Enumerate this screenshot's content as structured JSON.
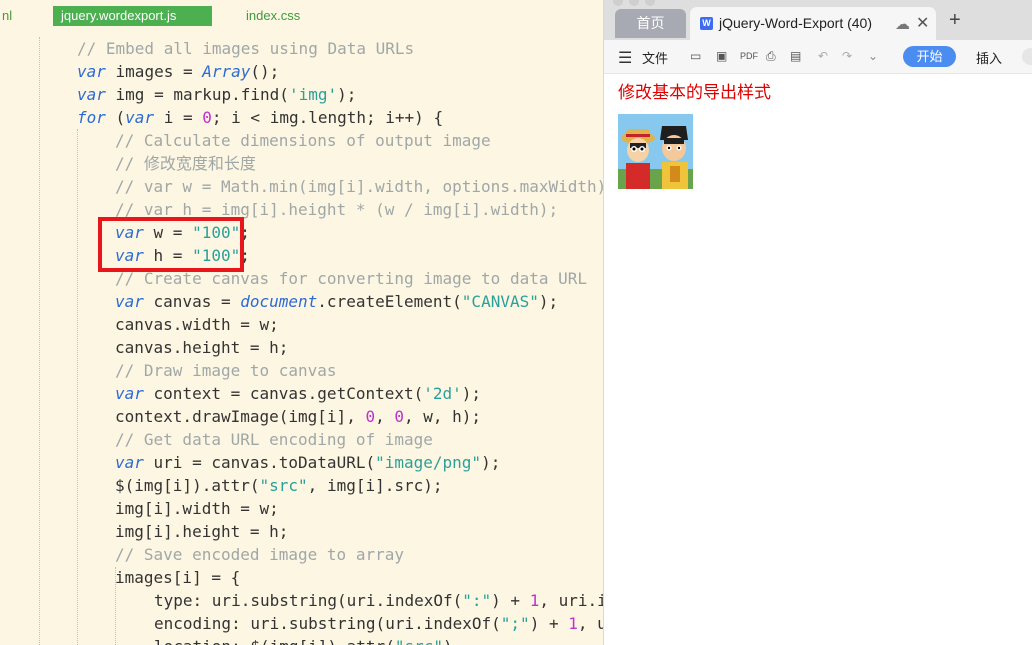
{
  "editor": {
    "tabs": [
      {
        "label": "nl"
      },
      {
        "label": "jquery.wordexport.js",
        "active": true
      },
      {
        "label": "index.css"
      }
    ],
    "lines": [
      [
        {
          "t": "// Embed all images using Data URLs",
          "c": "cm"
        }
      ],
      [
        {
          "t": "var",
          "c": "kw"
        },
        {
          "t": " images = "
        },
        {
          "t": "Array",
          "c": "ty"
        },
        {
          "t": "();"
        }
      ],
      [
        {
          "t": "var",
          "c": "kw"
        },
        {
          "t": " img = markup.find("
        },
        {
          "t": "'img'",
          "c": "st"
        },
        {
          "t": ");"
        }
      ],
      [
        {
          "t": "for",
          "c": "kw"
        },
        {
          "t": " ("
        },
        {
          "t": "var",
          "c": "kw"
        },
        {
          "t": " i = "
        },
        {
          "t": "0",
          "c": "nu"
        },
        {
          "t": "; i < img.length; i++) {"
        }
      ],
      [
        {
          "t": "// Calculate dimensions of output image",
          "c": "cm"
        }
      ],
      [
        {
          "t": "// 修改宽度和长度",
          "c": "cm"
        }
      ],
      [
        {
          "t": "// var w = Math.min(img[i].width, options.maxWidth);",
          "c": "cm"
        }
      ],
      [
        {
          "t": "// var h = img[i].height * (w / img[i].width);",
          "c": "cm"
        }
      ],
      [
        {
          "t": "var",
          "c": "kw"
        },
        {
          "t": " w = "
        },
        {
          "t": "\"100\"",
          "c": "st"
        },
        {
          "t": ";"
        }
      ],
      [
        {
          "t": "var",
          "c": "kw"
        },
        {
          "t": " h = "
        },
        {
          "t": "\"100\"",
          "c": "st"
        },
        {
          "t": ";"
        }
      ],
      [
        {
          "t": "// Create canvas for converting image to data URL",
          "c": "cm"
        }
      ],
      [
        {
          "t": "var",
          "c": "kw"
        },
        {
          "t": " canvas = "
        },
        {
          "t": "document",
          "c": "ty"
        },
        {
          "t": ".createElement("
        },
        {
          "t": "\"CANVAS\"",
          "c": "st"
        },
        {
          "t": ");"
        }
      ],
      [
        {
          "t": "canvas.width = w;"
        }
      ],
      [
        {
          "t": "canvas.height = h;"
        }
      ],
      [
        {
          "t": "// Draw image to canvas",
          "c": "cm"
        }
      ],
      [
        {
          "t": "var",
          "c": "kw"
        },
        {
          "t": " context = canvas.getContext("
        },
        {
          "t": "'2d'",
          "c": "st"
        },
        {
          "t": ");"
        }
      ],
      [
        {
          "t": "context.drawImage(img[i], "
        },
        {
          "t": "0",
          "c": "nu"
        },
        {
          "t": ", "
        },
        {
          "t": "0",
          "c": "nu"
        },
        {
          "t": ", w, h);"
        }
      ],
      [
        {
          "t": "// Get data URL encoding of image",
          "c": "cm"
        }
      ],
      [
        {
          "t": "var",
          "c": "kw"
        },
        {
          "t": " uri = canvas.toDataURL("
        },
        {
          "t": "\"image/png\"",
          "c": "st"
        },
        {
          "t": ");"
        }
      ],
      [
        {
          "t": "$(img[i]).attr("
        },
        {
          "t": "\"src\"",
          "c": "st"
        },
        {
          "t": ", img[i].src);"
        }
      ],
      [
        {
          "t": "img[i].width = w;"
        }
      ],
      [
        {
          "t": "img[i].height = h;"
        }
      ],
      [
        {
          "t": "// Save encoded image to array",
          "c": "cm"
        }
      ],
      [
        {
          "t": "images[i] = {"
        }
      ],
      [
        {
          "t": "type: uri.substring(uri.indexOf("
        },
        {
          "t": "\":\"",
          "c": "st"
        },
        {
          "t": ") + "
        },
        {
          "t": "1",
          "c": "nu"
        },
        {
          "t": ", uri.i"
        }
      ],
      [
        {
          "t": "encoding: uri.substring(uri.indexOf("
        },
        {
          "t": "\";\"",
          "c": "st"
        },
        {
          "t": ") + "
        },
        {
          "t": "1",
          "c": "nu"
        },
        {
          "t": ", u"
        }
      ],
      [
        {
          "t": "location: $(img[i]).attr("
        },
        {
          "t": "\"src\"",
          "c": "st"
        },
        {
          "t": "),"
        }
      ]
    ]
  },
  "browser": {
    "home_tab": "首页",
    "doc_tab": {
      "icon_letter": "W",
      "title": "jQuery-Word-Export (40)"
    },
    "toolbar": {
      "menu_label": "文件",
      "start_label": "开始",
      "insert_label": "插入"
    },
    "document": {
      "heading": "修改基本的导出样式",
      "image_alt": "cartoon image"
    }
  },
  "colors": {
    "highlight_border": "#e8151b",
    "start_button": "#4a8cf0",
    "heading_red": "#e00000",
    "active_tab": "#4caf50"
  }
}
